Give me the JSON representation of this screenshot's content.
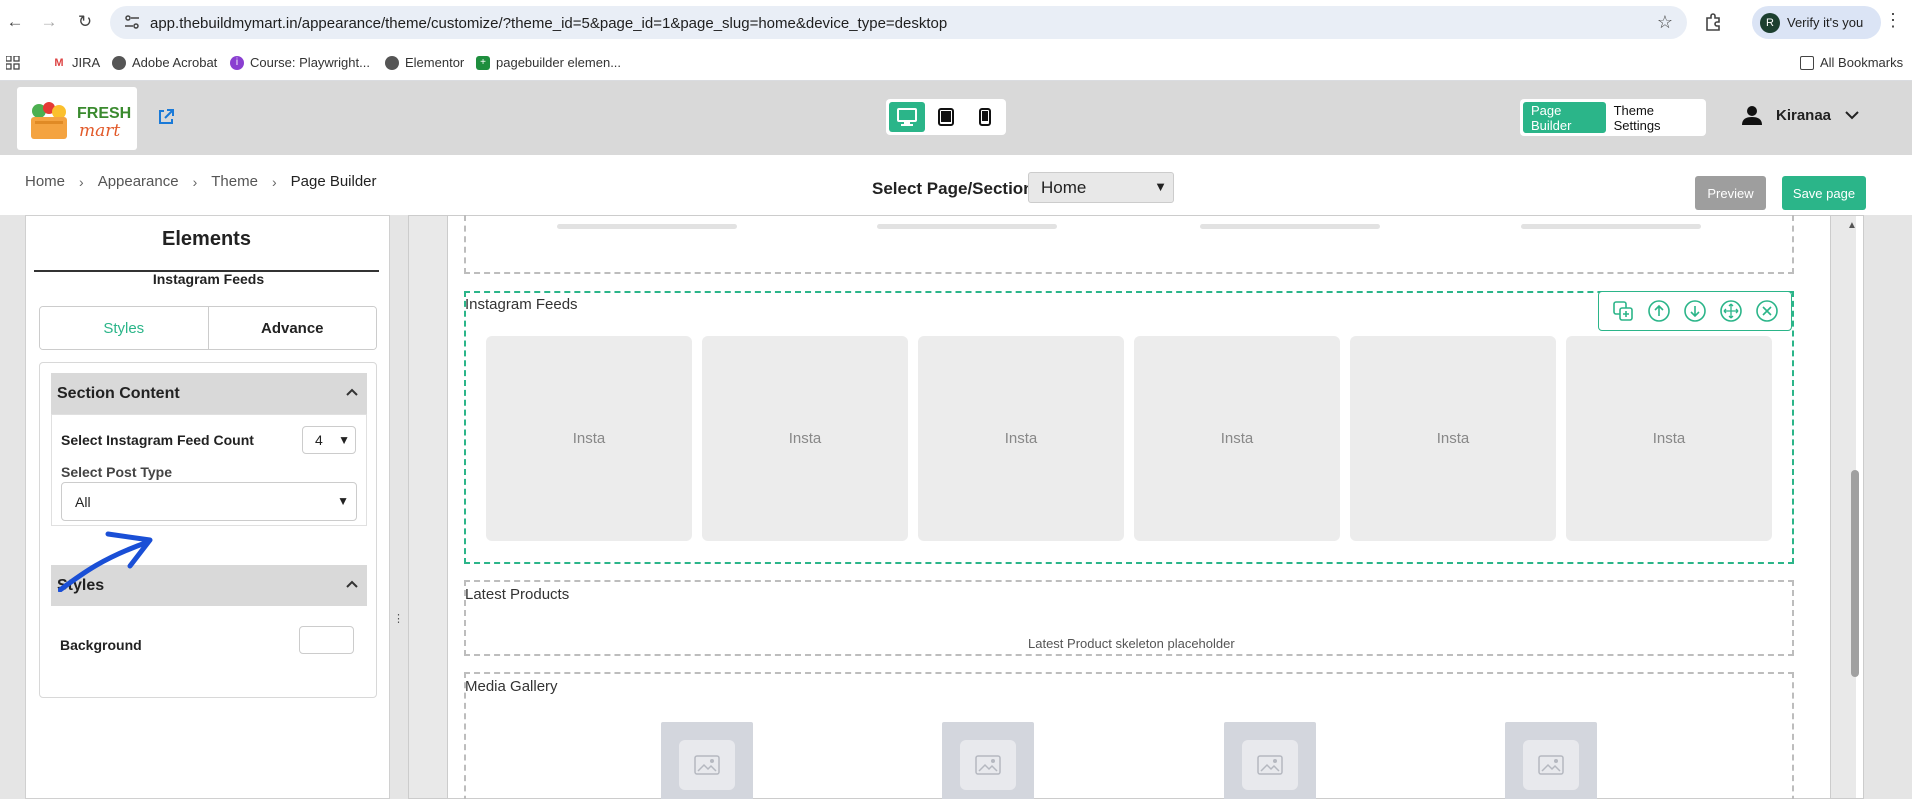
{
  "browser": {
    "url": "app.thebuildmymart.in/appearance/theme/customize/?theme_id=5&page_id=1&page_slug=home&device_type=desktop",
    "verify_label": "Verify it's you",
    "profile_initial": "R",
    "bookmarks": [
      "JIRA",
      "Adobe Acrobat",
      "Course: Playwright...",
      "Elementor",
      "pagebuilder elemen..."
    ],
    "all_bookmarks": "All Bookmarks"
  },
  "header": {
    "logo_top": "FRESH",
    "logo_bottom": "mart",
    "modes": [
      "Page Builder",
      "Theme Settings"
    ],
    "user_name": "Kiranaa"
  },
  "breadcrumb": [
    "Home",
    "Appearance",
    "Theme",
    "Page Builder"
  ],
  "page_select": {
    "label": "Select Page/Section:",
    "value": "Home"
  },
  "actions": {
    "preview": "Preview",
    "save": "Save page"
  },
  "left_panel": {
    "title": "Elements",
    "subtitle": "Instagram Feeds",
    "tabs": [
      "Styles",
      "Advance"
    ],
    "section_content": {
      "heading": "Section Content",
      "count_label": "Select Instagram Feed Count",
      "count_value": "4",
      "post_type_label": "Select Post Type",
      "post_type_value": "All"
    },
    "styles": {
      "heading": "Styles",
      "background_label": "Background"
    }
  },
  "canvas": {
    "instagram": {
      "title": "Instagram Feeds",
      "cards": [
        "Insta",
        "Insta",
        "Insta",
        "Insta",
        "Insta",
        "Insta"
      ]
    },
    "latest_products": {
      "title": "Latest Products",
      "placeholder": "Latest Product skeleton placeholder"
    },
    "media_gallery": {
      "title": "Media Gallery"
    }
  },
  "colors": {
    "accent": "#2bb589",
    "preview_bg": "#9e9e9e",
    "annotation": "#1a4fd6"
  }
}
